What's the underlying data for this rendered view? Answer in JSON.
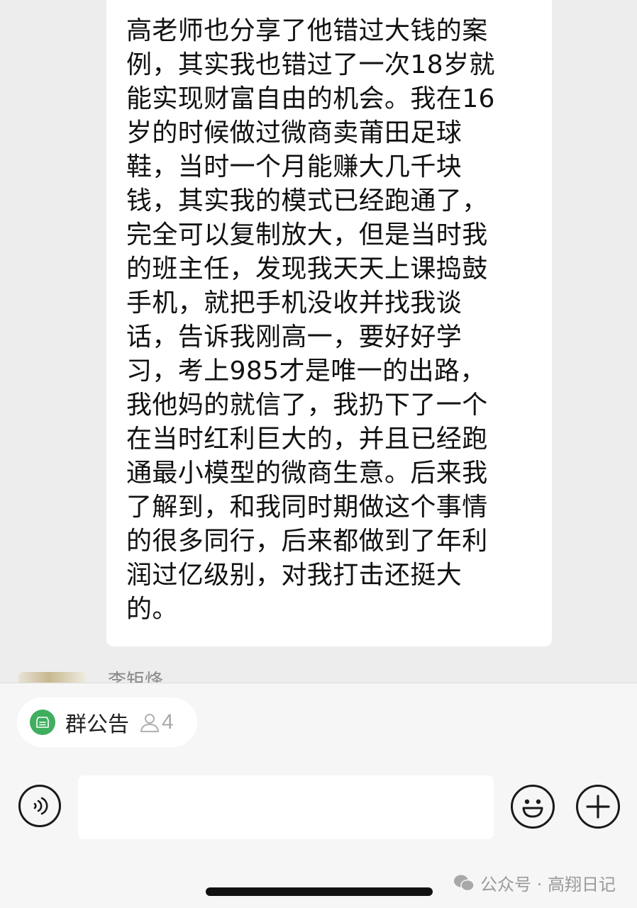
{
  "chat": {
    "message_text": "高老师也分享了他错过大钱的案\n例，其实我也错过了一次18岁就\n能实现财富自由的机会。我在16\n岁的时候做过微商卖莆田足球\n鞋，当时一个月能赚大几千块\n钱，其实我的模式已经跑通了，\n完全可以复制放大，但是当时我\n的班主任，发现我天天上课捣鼓\n手机，就把手机没收并找我谈\n话，告诉我刚高一，要好好学\n习，考上985才是唯一的出路，\n我他妈的就信了，我扔下了一个\n在当时红利巨大的，并且已经跑\n通最小模型的微商生意。后来我\n了解到，和我同时期做这个事情\n的很多同行，后来都做到了年利\n润过亿级别，对我打击还挺大\n的。",
    "next_sender_partial": "李矩烽"
  },
  "group_notice": {
    "label": "群公告",
    "count": "4",
    "icon": "notice-icon",
    "accent_color": "#3fae5f"
  },
  "input_bar": {
    "voice_icon": "voice-icon",
    "emoji_icon": "emoji-icon",
    "plus_icon": "plus-icon",
    "text_value": ""
  },
  "watermark": {
    "text": "公众号 · 高翔日记"
  }
}
